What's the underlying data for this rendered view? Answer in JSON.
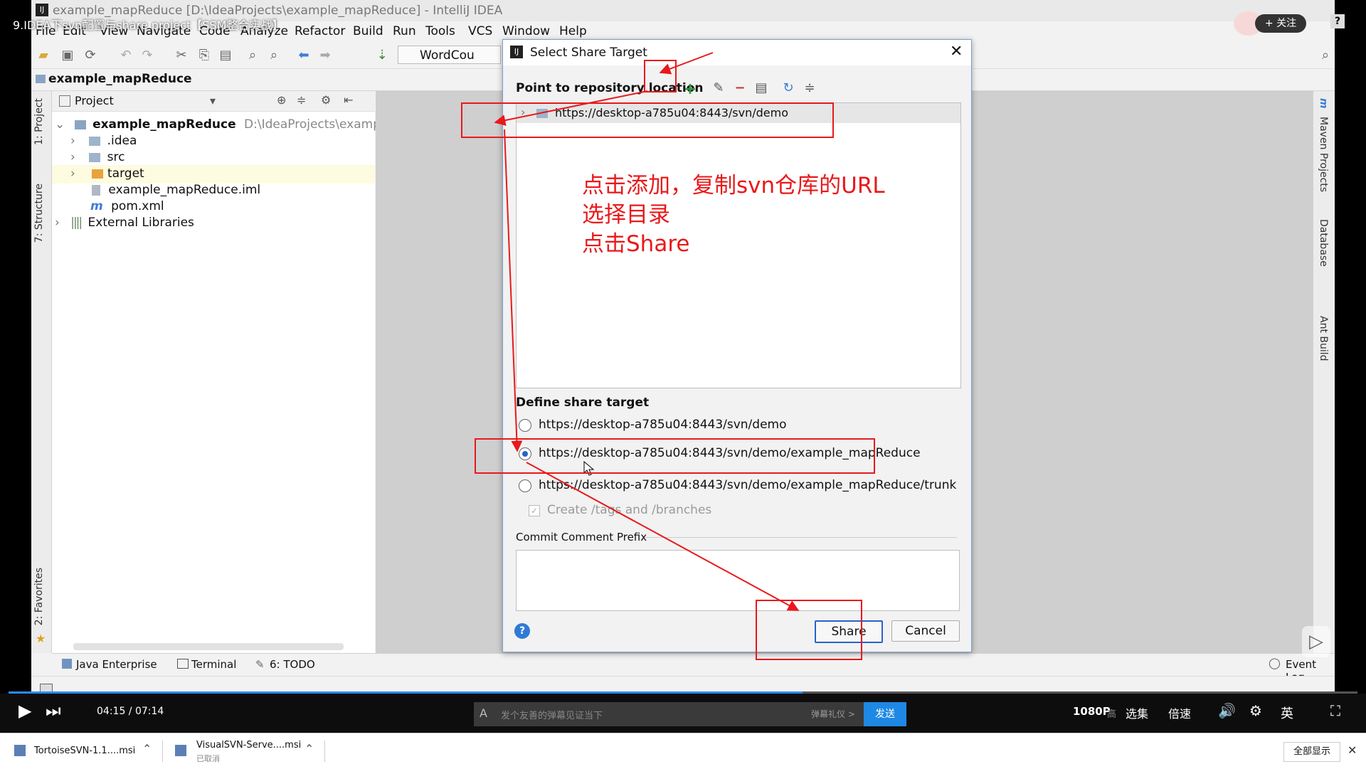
{
  "window": {
    "title": "example_mapReduce [D:\\IdeaProjects\\example_mapReduce] - IntelliJ IDEA"
  },
  "menu": [
    "File",
    "Edit",
    "View",
    "Navigate",
    "Code",
    "Analyze",
    "Refactor",
    "Build",
    "Run",
    "Tools",
    "VCS",
    "Window",
    "Help"
  ],
  "toolbar": {
    "run_config": "WordCou"
  },
  "breadcrumb": {
    "project": "example_mapReduce"
  },
  "side_tabs": {
    "project": "1: Project",
    "structure": "7: Structure",
    "favorites": "2: Favorites"
  },
  "right_tabs": {
    "maven": "Maven Projects",
    "database": "Database",
    "ant": "Ant Build"
  },
  "project_panel": {
    "header": "Project",
    "root": {
      "name": "example_mapReduce",
      "path": "D:\\IdeaProjects\\example_m"
    },
    "items": [
      ".idea",
      "src",
      "target",
      "example_mapReduce.iml",
      "pom.xml",
      "External Libraries"
    ]
  },
  "bottom_tabs": {
    "java_enterprise": "Java Enterprise",
    "terminal": "Terminal",
    "todo": "6: TODO",
    "event_log": "Event Log"
  },
  "dialog": {
    "title": "Select Share Target",
    "repo_label": "Point to repository location",
    "repo_url": "https://desktop-a785u04:8443/svn/demo",
    "define_label": "Define share target",
    "options": [
      {
        "label": "https://desktop-a785u04:8443/svn/demo",
        "selected": false
      },
      {
        "label": "https://desktop-a785u04:8443/svn/demo/example_mapReduce",
        "selected": true
      },
      {
        "label": "https://desktop-a785u04:8443/svn/demo/example_mapReduce/trunk",
        "selected": false
      }
    ],
    "create_tags": "Create /tags and /branches",
    "comment_label": "Commit Comment Prefix",
    "share_button": "Share",
    "cancel_button": "Cancel",
    "help": "?"
  },
  "annotation": {
    "line1": "点击添加，复制svn仓库的URL",
    "line2": "选择目录",
    "line3": "点击Share"
  },
  "video": {
    "title": "9.IDEA下svn配置与share project【SSM整合实战】",
    "follow": "+ 关注",
    "time": "04:15 / 07:14",
    "danmaku_placeholder": "发个友善的弹幕见证当下",
    "danmaku_etiquette": "弹幕礼仪 >",
    "send": "发送",
    "quality": "1080P",
    "quality_suffix": "高",
    "episodes": "选集",
    "speed": "倍速",
    "lang": "英"
  },
  "downloads": {
    "item1": "TortoiseSVN-1.1....msi",
    "item2": "VisualSVN-Serve....msi",
    "item2_status": "已取消",
    "show_all": "全部显示"
  },
  "colors": {
    "annotation": "#e8191b",
    "accent": "#2a62c9",
    "send_button": "#1e88e5"
  }
}
